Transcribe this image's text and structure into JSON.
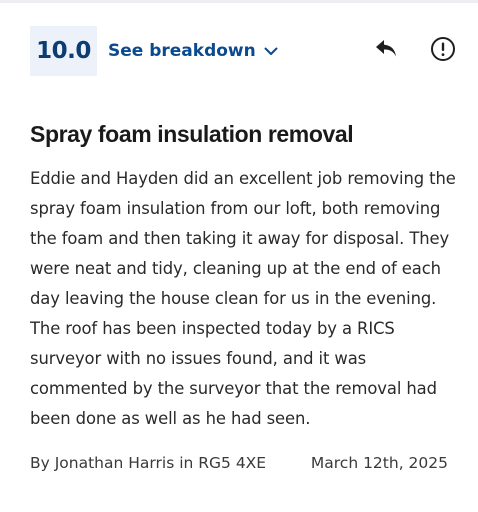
{
  "review": {
    "score": "10.0",
    "breakdown_label": "See breakdown",
    "icons": {
      "breakdown_chevron": "chevron-down-icon",
      "reply": "reply-icon",
      "report": "report-icon"
    },
    "title": "Spray foam insulation removal",
    "body": "Eddie and Hayden did an excellent job removing the spray foam insulation from our loft, both removing the foam and then taking it away for disposal.  They were neat and tidy, cleaning up at the end of each day leaving the house clean for us in the evening.  The roof has been inspected today by a RICS surveyor with no issues found, and it was commented by the surveyor that the removal had been done as well as he had seen.",
    "author_line": "By Jonathan Harris in RG5 4XE",
    "date": "March 12th, 2025"
  },
  "colors": {
    "score_badge_bg": "#edf2fa",
    "score_text": "#0b3c74",
    "link": "#0b4a8f",
    "text": "#2a2a2a"
  }
}
